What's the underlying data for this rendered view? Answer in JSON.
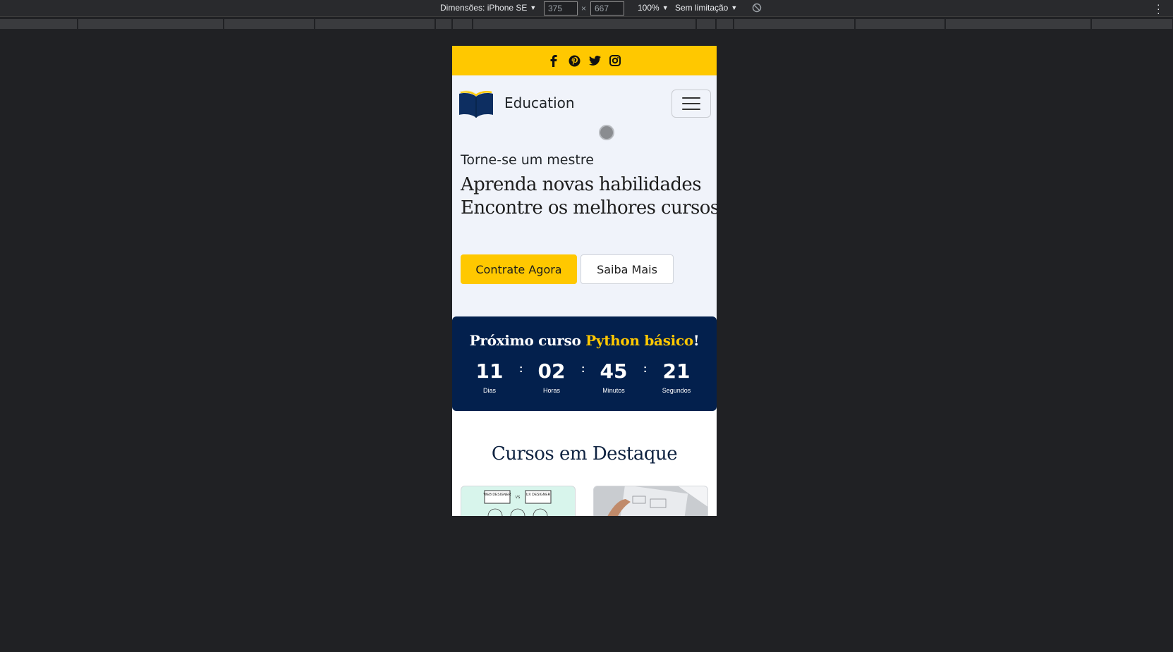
{
  "devtools": {
    "dimensions_label": "Dimensões: iPhone SE",
    "width_value": "375",
    "height_value": "667",
    "times_symbol": "×",
    "zoom": "100%",
    "throttle": "Sem limitação"
  },
  "social": {
    "icons": [
      "facebook-icon",
      "pinterest-icon",
      "twitter-icon",
      "instagram-icon"
    ]
  },
  "navbar": {
    "brand": "Education"
  },
  "hero": {
    "tagline": "Torne-se um mestre",
    "headline_line1": "Aprenda novas habilidades",
    "headline_line2": "Encontre os melhores cursos",
    "primary_button": "Contrate Agora",
    "secondary_button": "Saiba Mais"
  },
  "countdown": {
    "title_prefix": "Próximo curso ",
    "course_name": "Python básico",
    "title_suffix": "!",
    "units": [
      {
        "value": "11",
        "label": "Dias"
      },
      {
        "value": "02",
        "label": "Horas"
      },
      {
        "value": "45",
        "label": "Minutos"
      },
      {
        "value": "21",
        "label": "Segundos"
      }
    ],
    "separator": ":"
  },
  "featured": {
    "title": "Cursos em Destaque",
    "card1_tags": [
      "WEB DESIGNER",
      "VS",
      "UX DESIGNER"
    ]
  },
  "colors": {
    "accent_yellow": "#ffc800",
    "navy": "#03204d",
    "hero_bg": "#f0f3fa"
  }
}
